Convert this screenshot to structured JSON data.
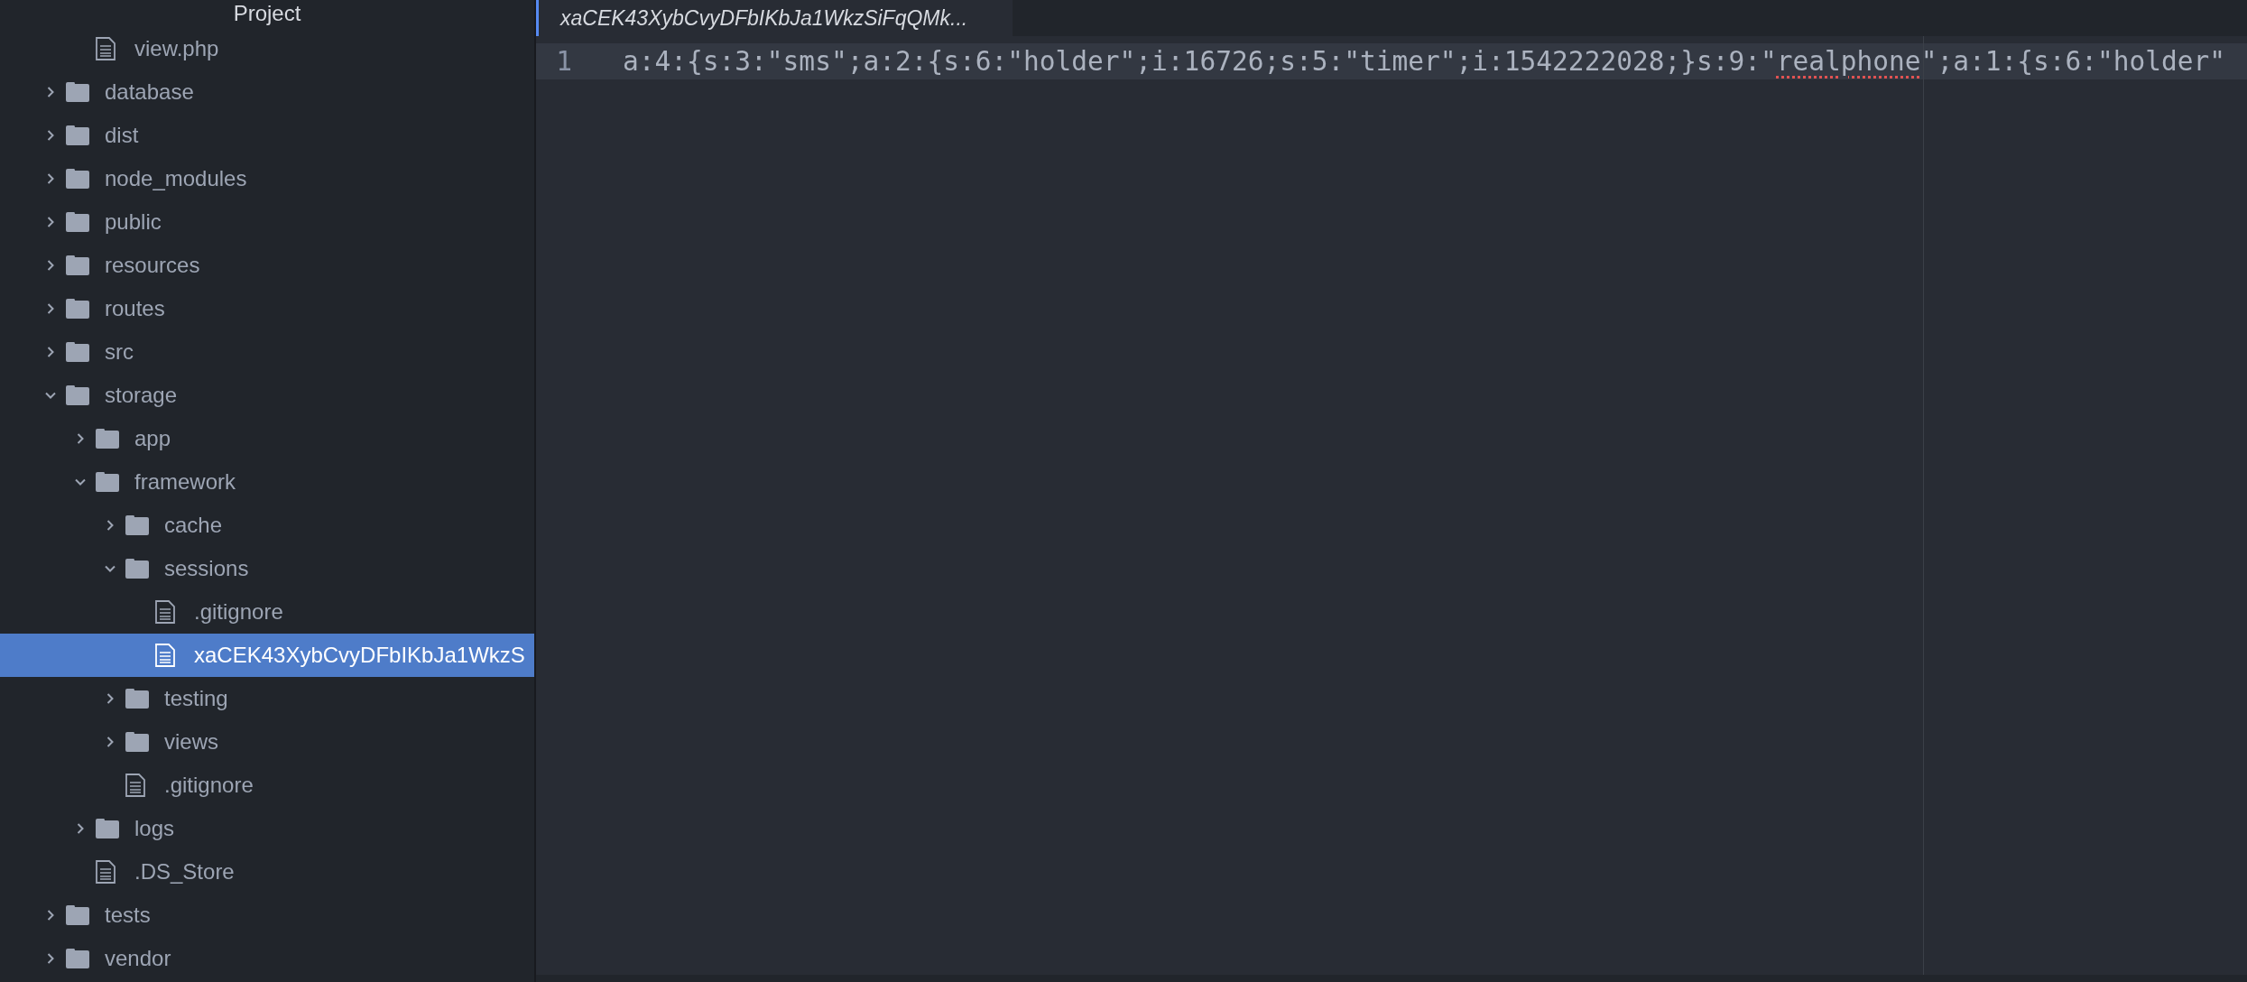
{
  "sidebar": {
    "title": "Project",
    "items": [
      {
        "children": [
          {
            "name": "view.php",
            "kind": "file",
            "selected": false
          }
        ]
      },
      {
        "name": "database",
        "kind": "folder",
        "expanded": false,
        "selected": false
      },
      {
        "name": "dist",
        "kind": "folder",
        "expanded": false,
        "selected": false
      },
      {
        "name": "node_modules",
        "kind": "folder",
        "expanded": false,
        "selected": false
      },
      {
        "name": "public",
        "kind": "folder",
        "expanded": false,
        "selected": false
      },
      {
        "name": "resources",
        "kind": "folder",
        "expanded": false,
        "selected": false
      },
      {
        "name": "routes",
        "kind": "folder",
        "expanded": false,
        "selected": false
      },
      {
        "name": "src",
        "kind": "folder",
        "expanded": false,
        "selected": false
      },
      {
        "name": "storage",
        "kind": "folder",
        "expanded": true,
        "selected": false,
        "children": [
          {
            "name": "app",
            "kind": "folder",
            "expanded": false,
            "selected": false
          },
          {
            "name": "framework",
            "kind": "folder",
            "expanded": true,
            "selected": false,
            "children": [
              {
                "name": "cache",
                "kind": "folder",
                "expanded": false,
                "selected": false
              },
              {
                "name": "sessions",
                "kind": "folder",
                "expanded": true,
                "selected": false,
                "children": [
                  {
                    "name": ".gitignore",
                    "kind": "file",
                    "selected": false
                  },
                  {
                    "name": "xaCEK43XybCvyDFbIKbJa1WkzS",
                    "kind": "file",
                    "selected": true
                  }
                ]
              },
              {
                "name": "testing",
                "kind": "folder",
                "expanded": false,
                "selected": false
              },
              {
                "name": "views",
                "kind": "folder",
                "expanded": false,
                "selected": false
              },
              {
                "name": ".gitignore",
                "kind": "file",
                "selected": false
              }
            ]
          },
          {
            "name": "logs",
            "kind": "folder",
            "expanded": false,
            "selected": false
          },
          {
            "name": ".DS_Store",
            "kind": "file",
            "selected": false
          }
        ]
      },
      {
        "name": "tests",
        "kind": "folder",
        "expanded": false,
        "selected": false
      },
      {
        "name": "vendor",
        "kind": "folder",
        "expanded": false,
        "selected": false
      }
    ]
  },
  "tabs": [
    {
      "label": "xaCEK43XybCvyDFbIKbJa1WkzSiFqQMk...",
      "selected": true
    }
  ],
  "editor": {
    "lines": [
      {
        "number": "1",
        "current": true,
        "segments": [
          {
            "text": "a:4:{s:3:\"sms\";a:2:{s:6:\"holder\";i:16726;s:5:\"timer\";i:1542222028;}s:9:\"",
            "misspelled": false
          },
          {
            "text": "realphone",
            "misspelled": true
          },
          {
            "text": "\";a:1:{s:6:\"holder\"",
            "misspelled": false
          }
        ]
      }
    ]
  }
}
